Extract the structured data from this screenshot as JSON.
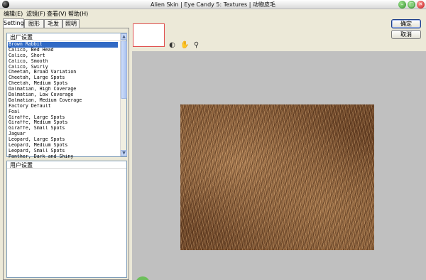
{
  "window": {
    "title": "Alien Skin | Eye Candy 5: Textures | 动物皮毛"
  },
  "menu": {
    "items": [
      "编辑(E)",
      "滤镜(F)",
      "查看(V)",
      "帮助(H)"
    ]
  },
  "tabs": [
    {
      "label": "Settings",
      "active": true
    },
    {
      "label": "图形",
      "active": false
    },
    {
      "label": "毛发",
      "active": false
    },
    {
      "label": "照明",
      "active": false
    }
  ],
  "factory_settings": {
    "header": "出厂设置",
    "items": [
      "Brown Rabbit",
      "Calico, Bed Head",
      "Calico, Short",
      "Calico, Smooth",
      "Calico, Swirly",
      "Cheetah, Broad Variation",
      "Cheetah, Large Spots",
      "Cheetah, Medium Spots",
      "Dalmatian, High Coverage",
      "Dalmatian, Low Coverage",
      "Dalmatian, Medium Coverage",
      "Factory Default",
      "Foal",
      "Giraffe, Large Spots",
      "Giraffe, Medium Spots",
      "Giraffe, Small Spots",
      "Jaguar",
      "Leopard, Large Spots",
      "Leopard, Medium Spots",
      "Leopard, Small Spots",
      "Panther, Dark and Shiny"
    ],
    "selected": "Brown Rabbit"
  },
  "user_settings": {
    "header": "用户设置"
  },
  "buttons": {
    "ok": "确定",
    "cancel": "取消"
  },
  "colors": {
    "selection": "#316ac5",
    "canvas_bg": "#c0c0c0",
    "preview_border": "#e05050"
  }
}
